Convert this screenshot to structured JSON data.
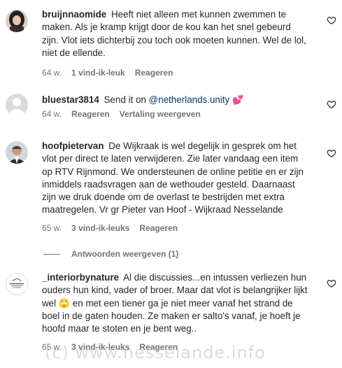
{
  "comments": [
    {
      "username": "bruijnnaomide",
      "text": "Heeft niet alleen met kunnen zwemmen te maken. Als je kramp krijgt door de kou kan het snel gebeurd zijn. Vlot iets dichterbij zou toch ook moeten kunnen. Wel de lol, niet de ellende.",
      "time": "64 w.",
      "likes": "1 vind-ik-leuk",
      "reply": "Reageren"
    },
    {
      "username": "bluestar3814",
      "text_prefix": "Send it on",
      "mention": "@netherlands.unity",
      "emoji": "💕",
      "time": "64 w.",
      "reply": "Reageren",
      "translate": "Vertaling weergeven"
    },
    {
      "username": "hoofpietervan",
      "text": "De Wijkraak is wel degelijk in gesprek om het vlot per direct te laten verwijderen. Zie later vandaag een item op RTV Rijnmond. We ondersteunen de online petitie en er zijn inmiddels raadsvragen aan de wethouder gesteld. Daarnaast zijn we druk doende om de overlast te bestrijden met extra maatregelen. Vr gr Pieter van Hoof - Wijkraad Nesselande",
      "time": "65 w.",
      "likes": "3 vind-ik-leuks",
      "reply": "Reageren"
    },
    {
      "username": "_interiorbynature",
      "text_a": "Al die discussies...en intussen verliezen hun ouders hun kind, vader of broer. Maar dat vlot is belangrijker lijkt wel",
      "emoji": "🙄",
      "text_b": "en met een tiener ga je niet meer vanaf het strand de boel in de gaten houden. Ze maken er salto's vanaf, je hoeft je hoofd maar te stoten en je bent weg..",
      "avatar_text": "INTERIOR by NATURE",
      "time": "65 w.",
      "likes": "3 vind-ik-leuks",
      "reply": "Reageren"
    }
  ],
  "replies_toggle": "Antwoorden weergeven (1)",
  "watermark": "(c) www.nesselande.info",
  "colors": {
    "text": "#262626",
    "secondary": "#737373",
    "mention": "#00376b"
  }
}
